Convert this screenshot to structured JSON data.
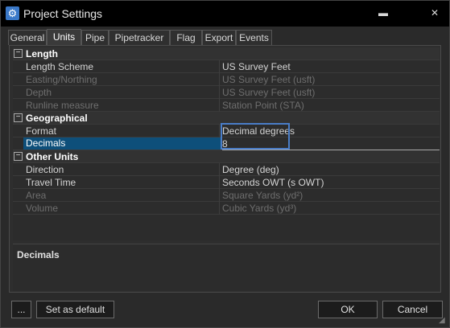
{
  "window": {
    "title": "Project Settings",
    "minimize_glyph": "▬",
    "close_glyph": "✕"
  },
  "tabs": [
    {
      "label": "General",
      "active": false
    },
    {
      "label": "Units",
      "active": true
    },
    {
      "label": "Pipe",
      "active": false
    },
    {
      "label": "Pipetracker",
      "active": false
    },
    {
      "label": "Flag",
      "active": false
    },
    {
      "label": "Export",
      "active": false
    },
    {
      "label": "Events",
      "active": false
    }
  ],
  "grid": {
    "categories": {
      "length": {
        "label": "Length",
        "expander": "−"
      },
      "geographical": {
        "label": "Geographical",
        "expander": "−"
      },
      "other_units": {
        "label": "Other Units",
        "expander": "−"
      }
    },
    "rows": {
      "length_scheme": {
        "name": "Length Scheme",
        "value": "US Survey Feet",
        "enabled": true
      },
      "easting_northing": {
        "name": "Easting/Northing",
        "value": "US Survey Feet (usft)",
        "enabled": false
      },
      "depth": {
        "name": "Depth",
        "value": "US Survey Feet (usft)",
        "enabled": false
      },
      "runline_measure": {
        "name": "Runline measure",
        "value": "Station Point (STA)",
        "enabled": false
      },
      "format": {
        "name": "Format",
        "value": "Decimal degrees",
        "enabled": true
      },
      "decimals": {
        "name": "Decimals",
        "value": "8",
        "enabled": true,
        "selected": true
      },
      "direction": {
        "name": "Direction",
        "value": "Degree (deg)",
        "enabled": true
      },
      "travel_time": {
        "name": "Travel Time",
        "value": "Seconds OWT (s OWT)",
        "enabled": true
      },
      "area": {
        "name": "Area",
        "value": "Square Yards (yd²)",
        "enabled": false
      },
      "volume": {
        "name": "Volume",
        "value": "Cubic Yards (yd³)",
        "enabled": false
      }
    }
  },
  "description": {
    "title": "Decimals"
  },
  "buttons": {
    "more": "...",
    "set_default": "Set as default",
    "ok": "OK",
    "cancel": "Cancel"
  }
}
